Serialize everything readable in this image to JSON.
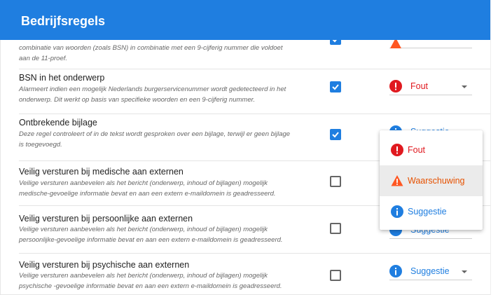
{
  "header": {
    "title": "Bedrijfsregels"
  },
  "rules": [
    {
      "title": "",
      "desc_lines": [
        "combinatie van woorden (zoals BSN) in combinatie met een 9-cijferig nummer die voldoet",
        "aan de 11-proef."
      ],
      "checked": true
    },
    {
      "title": "BSN in het onderwerp",
      "desc_lines": [
        "Alarmeert indien een mogelijk Nederlands burgerservicenummer wordt gedetecteerd in het",
        "onderwerp. Dit werkt op basis van specifieke woorden en een 9-cijferig nummer."
      ],
      "checked": true,
      "severity": "Fout"
    },
    {
      "title": "Ontbrekende bijlage",
      "desc_lines": [
        "Deze regel controleert of in de tekst wordt gesproken over een bijlage, terwijl er geen bijlage",
        "is toegevoegd."
      ],
      "checked": true,
      "severity": "Suggestie"
    },
    {
      "title": "Veilig versturen bij medische aan externen",
      "desc_lines": [
        "Veilige versturen aanbevelen als het bericht (onderwerp, inhoud of bijlagen) mogelijk",
        "medische-gevoelige informatie bevat en aan een extern e-maildomein is geadresseerd."
      ],
      "checked": false
    },
    {
      "title": "Veilig versturen bij persoonlijke aan externen",
      "desc_lines": [
        "Veilige versturen aanbevelen als het bericht (onderwerp, inhoud of bijlagen) mogelijk",
        "persoonlijke-gevoelige informatie bevat en aan een extern e-maildomein is geadresseerd."
      ],
      "checked": false,
      "severity": "Suggestie"
    },
    {
      "title": "Veilig versturen bij psychische aan externen",
      "desc_lines": [
        "Veilige versturen aanbevelen als het bericht (onderwerp, inhoud of bijlagen) mogelijk",
        "psychische -gevoelige informatie bevat en aan een extern e-maildomein is geadresseerd."
      ],
      "checked": false,
      "severity": "Suggestie"
    }
  ],
  "menu": {
    "options": [
      "Fout",
      "Waarschuwing",
      "Suggestie"
    ],
    "hovered": "Waarschuwing"
  },
  "colors": {
    "header": "#1f7ee0",
    "error": "#e0191f",
    "warning": "#ff5722",
    "info": "#1f7ee0"
  },
  "icons": {
    "error": "exclamation-circle-icon",
    "warning": "warning-triangle-icon",
    "info": "info-circle-icon"
  }
}
